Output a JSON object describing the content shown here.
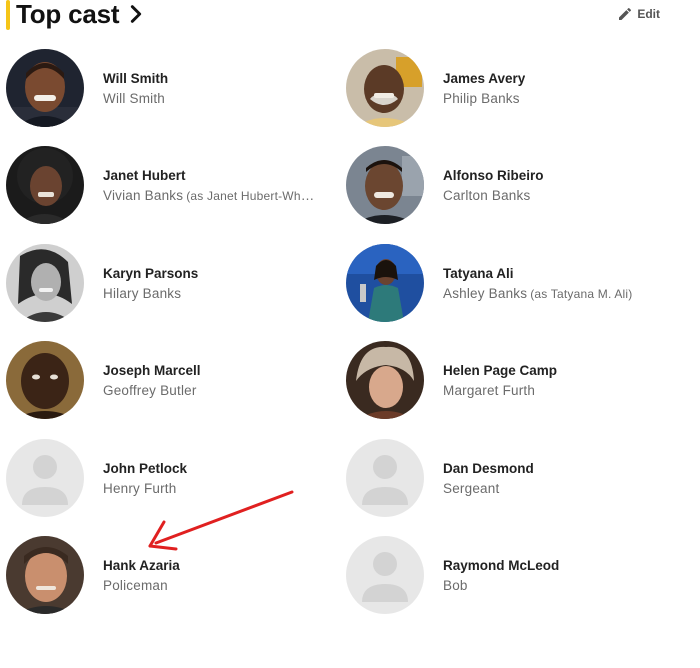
{
  "header": {
    "title": "Top cast",
    "edit_label": "Edit",
    "accent_color": "#f5c518"
  },
  "cast": [
    {
      "actor": "Will Smith",
      "role": "Will Smith",
      "note": "",
      "avatar": "photo"
    },
    {
      "actor": "James Avery",
      "role": "Philip Banks",
      "note": "",
      "avatar": "photo"
    },
    {
      "actor": "Janet Hubert",
      "role": "Vivian Banks",
      "note": "(as Janet Hubert-Whitt…",
      "avatar": "photo"
    },
    {
      "actor": "Alfonso Ribeiro",
      "role": "Carlton Banks",
      "note": "",
      "avatar": "photo"
    },
    {
      "actor": "Karyn Parsons",
      "role": "Hilary Banks",
      "note": "",
      "avatar": "photo"
    },
    {
      "actor": "Tatyana Ali",
      "role": "Ashley Banks",
      "note": "(as Tatyana M. Ali)",
      "avatar": "photo"
    },
    {
      "actor": "Joseph Marcell",
      "role": "Geoffrey Butler",
      "note": "",
      "avatar": "photo"
    },
    {
      "actor": "Helen Page Camp",
      "role": "Margaret Furth",
      "note": "",
      "avatar": "photo"
    },
    {
      "actor": "John Petlock",
      "role": "Henry Furth",
      "note": "",
      "avatar": "placeholder"
    },
    {
      "actor": "Dan Desmond",
      "role": "Sergeant",
      "note": "",
      "avatar": "placeholder"
    },
    {
      "actor": "Hank Azaria",
      "role": "Policeman",
      "note": "",
      "avatar": "photo"
    },
    {
      "actor": "Raymond McLeod",
      "role": "Bob",
      "note": "",
      "avatar": "placeholder"
    }
  ],
  "annotation": {
    "type": "red-arrow",
    "color": "#e02020",
    "points_to": "Hank Azaria"
  }
}
